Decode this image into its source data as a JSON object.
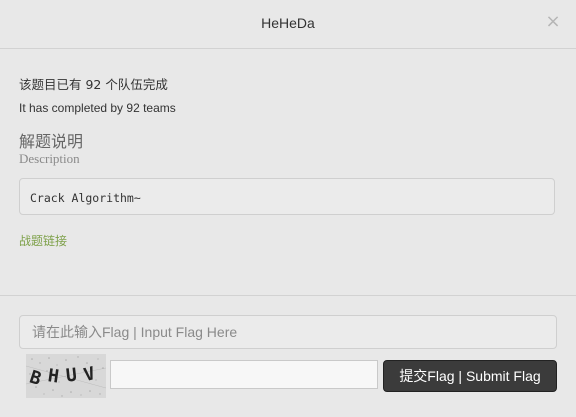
{
  "modal": {
    "title": "HeHeDa",
    "close_glyph": "×",
    "solved_count_cn": "该题目已有 92 个队伍完成",
    "solved_count_en": "It has completed by 92 teams",
    "description_heading_cn": "解题说明",
    "description_heading_en": "Description",
    "description_body": "Crack Algorithm~",
    "challenge_link": "战题链接",
    "flag_placeholder": "请在此输入Flag | Input Flag Here",
    "captcha_text": "BHUV",
    "captcha_input_value": "",
    "submit_label": "提交Flag | Submit Flag"
  },
  "colors": {
    "background": "#e8e8e8",
    "link": "#7ea14a",
    "submit_bg": "#3b3b3b"
  },
  "icons": {
    "close": "close-icon",
    "captcha": "captcha-image"
  }
}
